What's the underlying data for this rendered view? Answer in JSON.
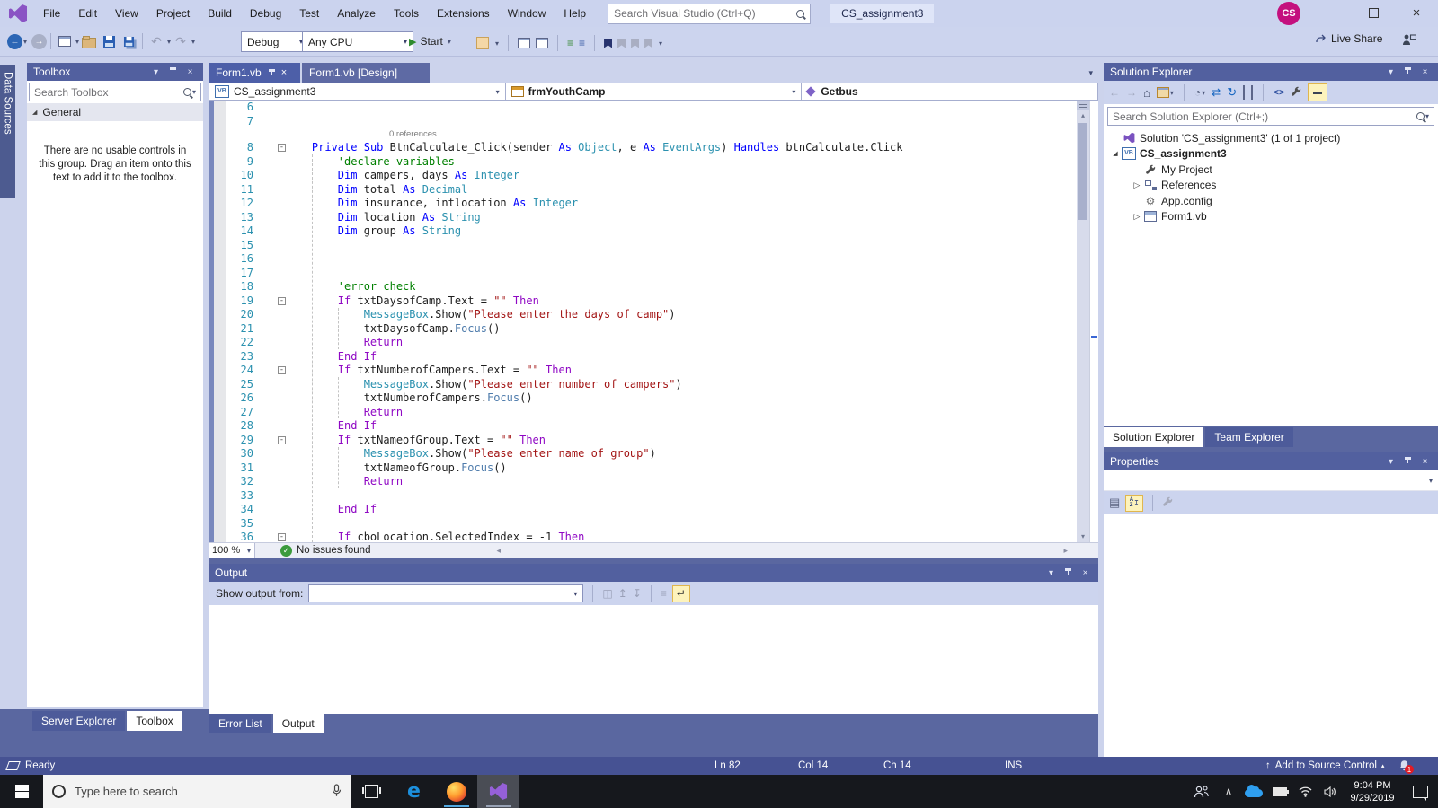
{
  "colors": {
    "accent_tab": "#4D5FA8",
    "dock_bg": "#5A67A0",
    "panel_header": "#52609F",
    "statusbar": "#465293",
    "taskbar": "#16181D",
    "avatar": "#C4107E",
    "start_green": "#2E8B2E",
    "badge_red": "#E11B24"
  },
  "icons": {
    "chevron_down": "▾",
    "chevron_up": "▴",
    "close": "×",
    "check": "✓",
    "play": "▶",
    "back": "←",
    "forward": "→",
    "undo": "↶",
    "redo": "↷",
    "refresh": "↻",
    "sync": "⇄",
    "home": "⌂",
    "collapsed": "▷",
    "expanded": "◢",
    "up_arrow": "↑",
    "left_small": "◂",
    "right_small": "▸",
    "clock": "◔",
    "code_tags": "<>",
    "wrap": "↵",
    "column_icon": "◫",
    "up_bar": "↥",
    "down_bar": "↧",
    "lines": "≡",
    "chevron_taskbar": "∧",
    "grid": "▤"
  },
  "titlebar": {
    "menu": [
      "File",
      "Edit",
      "View",
      "Project",
      "Build",
      "Debug",
      "Test",
      "Analyze",
      "Tools",
      "Extensions",
      "Window",
      "Help"
    ],
    "search_placeholder": "Search Visual Studio (Ctrl+Q)",
    "session_label": "CS_assignment3",
    "avatar_initials": "CS"
  },
  "toolbar": {
    "config": "Debug",
    "platform": "Any CPU",
    "start_label": "Start",
    "live_share_label": "Live Share"
  },
  "toolbox": {
    "title": "Toolbox",
    "search_placeholder": "Search Toolbox",
    "group_label": "General",
    "empty_message": "There are no usable controls in this group. Drag an item onto this text to add it to the toolbox.",
    "side_tab": "Data Sources",
    "bottom_tabs": [
      {
        "label": "Server Explorer",
        "active": false
      },
      {
        "label": "Toolbox",
        "active": true
      }
    ]
  },
  "editor": {
    "tabs": [
      {
        "label": "Form1.vb",
        "active": true
      },
      {
        "label": "Form1.vb [Design]",
        "active": false
      }
    ],
    "nav_project": "CS_assignment3",
    "nav_type": "frmYouthCamp",
    "nav_member": "Getbus",
    "zoom_level": "100 %",
    "health_status": "No issues found",
    "syntax": {
      "k": "#0000FF",
      "t": "#2B91AF",
      "c": "#008000",
      "s": "#A31515",
      "p": "#8F08C4",
      "d": "#1E1E1E",
      "m": "#4F7CAC"
    },
    "code_lines": [
      {
        "n": "6",
        "parts": []
      },
      {
        "n": "7",
        "parts": []
      },
      {
        "lens": "0 references"
      },
      {
        "n": "8",
        "fold": true,
        "parts": [
          [
            "d",
            "    "
          ],
          [
            "k",
            "Private"
          ],
          [
            "d",
            " "
          ],
          [
            "k",
            "Sub"
          ],
          [
            "d",
            " BtnCalculate_Click(sender "
          ],
          [
            "k",
            "As"
          ],
          [
            "d",
            " "
          ],
          [
            "t",
            "Object"
          ],
          [
            "d",
            ", e "
          ],
          [
            "k",
            "As"
          ],
          [
            "d",
            " "
          ],
          [
            "t",
            "EventArgs"
          ],
          [
            "d",
            ") "
          ],
          [
            "k",
            "Handles"
          ],
          [
            "d",
            " btnCalculate.Click"
          ]
        ]
      },
      {
        "n": "9",
        "parts": [
          [
            "c",
            "        'declare variables"
          ]
        ]
      },
      {
        "n": "10",
        "parts": [
          [
            "d",
            "        "
          ],
          [
            "k",
            "Dim"
          ],
          [
            "d",
            " campers, days "
          ],
          [
            "k",
            "As"
          ],
          [
            "d",
            " "
          ],
          [
            "t",
            "Integer"
          ]
        ]
      },
      {
        "n": "11",
        "parts": [
          [
            "d",
            "        "
          ],
          [
            "k",
            "Dim"
          ],
          [
            "d",
            " total "
          ],
          [
            "k",
            "As"
          ],
          [
            "d",
            " "
          ],
          [
            "t",
            "Decimal"
          ]
        ]
      },
      {
        "n": "12",
        "parts": [
          [
            "d",
            "        "
          ],
          [
            "k",
            "Dim"
          ],
          [
            "d",
            " insurance, intlocation "
          ],
          [
            "k",
            "As"
          ],
          [
            "d",
            " "
          ],
          [
            "t",
            "Integer"
          ]
        ]
      },
      {
        "n": "13",
        "parts": [
          [
            "d",
            "        "
          ],
          [
            "k",
            "Dim"
          ],
          [
            "d",
            " location "
          ],
          [
            "k",
            "As"
          ],
          [
            "d",
            " "
          ],
          [
            "t",
            "String"
          ]
        ]
      },
      {
        "n": "14",
        "parts": [
          [
            "d",
            "        "
          ],
          [
            "k",
            "Dim"
          ],
          [
            "d",
            " group "
          ],
          [
            "k",
            "As"
          ],
          [
            "d",
            " "
          ],
          [
            "t",
            "String"
          ]
        ]
      },
      {
        "n": "15",
        "parts": []
      },
      {
        "n": "16",
        "parts": []
      },
      {
        "n": "17",
        "parts": []
      },
      {
        "n": "18",
        "parts": [
          [
            "c",
            "        'error check"
          ]
        ]
      },
      {
        "n": "19",
        "fold": true,
        "parts": [
          [
            "d",
            "        "
          ],
          [
            "p",
            "If"
          ],
          [
            "d",
            " txtDaysofCamp.Text = "
          ],
          [
            "s",
            "\"\""
          ],
          [
            "d",
            " "
          ],
          [
            "p",
            "Then"
          ]
        ]
      },
      {
        "n": "20",
        "parts": [
          [
            "d",
            "            "
          ],
          [
            "t",
            "MessageBox"
          ],
          [
            "d",
            ".Show("
          ],
          [
            "s",
            "\"Please enter the days of camp\""
          ],
          [
            "d",
            ")"
          ]
        ]
      },
      {
        "n": "21",
        "parts": [
          [
            "d",
            "            txtDaysofCamp."
          ],
          [
            "m",
            "Focus"
          ],
          [
            "d",
            "()"
          ]
        ]
      },
      {
        "n": "22",
        "parts": [
          [
            "d",
            "            "
          ],
          [
            "p",
            "Return"
          ]
        ]
      },
      {
        "n": "23",
        "parts": [
          [
            "d",
            "        "
          ],
          [
            "p",
            "End If"
          ]
        ]
      },
      {
        "n": "24",
        "fold": true,
        "parts": [
          [
            "d",
            "        "
          ],
          [
            "p",
            "If"
          ],
          [
            "d",
            " txtNumberofCampers.Text = "
          ],
          [
            "s",
            "\"\""
          ],
          [
            "d",
            " "
          ],
          [
            "p",
            "Then"
          ]
        ]
      },
      {
        "n": "25",
        "parts": [
          [
            "d",
            "            "
          ],
          [
            "t",
            "MessageBox"
          ],
          [
            "d",
            ".Show("
          ],
          [
            "s",
            "\"Please enter number of campers\""
          ],
          [
            "d",
            ")"
          ]
        ]
      },
      {
        "n": "26",
        "parts": [
          [
            "d",
            "            txtNumberofCampers."
          ],
          [
            "m",
            "Focus"
          ],
          [
            "d",
            "()"
          ]
        ]
      },
      {
        "n": "27",
        "parts": [
          [
            "d",
            "            "
          ],
          [
            "p",
            "Return"
          ]
        ]
      },
      {
        "n": "28",
        "parts": [
          [
            "d",
            "        "
          ],
          [
            "p",
            "End If"
          ]
        ]
      },
      {
        "n": "29",
        "fold": true,
        "parts": [
          [
            "d",
            "        "
          ],
          [
            "p",
            "If"
          ],
          [
            "d",
            " txtNameofGroup.Text = "
          ],
          [
            "s",
            "\"\""
          ],
          [
            "d",
            " "
          ],
          [
            "p",
            "Then"
          ]
        ]
      },
      {
        "n": "30",
        "parts": [
          [
            "d",
            "            "
          ],
          [
            "t",
            "MessageBox"
          ],
          [
            "d",
            ".Show("
          ],
          [
            "s",
            "\"Please enter name of group\""
          ],
          [
            "d",
            ")"
          ]
        ]
      },
      {
        "n": "31",
        "parts": [
          [
            "d",
            "            txtNameofGroup."
          ],
          [
            "m",
            "Focus"
          ],
          [
            "d",
            "()"
          ]
        ]
      },
      {
        "n": "32",
        "parts": [
          [
            "d",
            "            "
          ],
          [
            "p",
            "Return"
          ]
        ]
      },
      {
        "n": "33",
        "parts": []
      },
      {
        "n": "34",
        "parts": [
          [
            "d",
            "        "
          ],
          [
            "p",
            "End If"
          ]
        ]
      },
      {
        "n": "35",
        "parts": []
      },
      {
        "n": "36",
        "fold": true,
        "parts": [
          [
            "d",
            "        "
          ],
          [
            "p",
            "If"
          ],
          [
            "d",
            " cboLocation.SelectedIndex = -1 "
          ],
          [
            "p",
            "Then"
          ]
        ]
      }
    ]
  },
  "output": {
    "title": "Output",
    "show_output_from_label": "Show output from:",
    "bottom_tabs": [
      {
        "label": "Error List",
        "active": false
      },
      {
        "label": "Output",
        "active": true
      }
    ]
  },
  "solution_explorer": {
    "title": "Solution Explorer",
    "search_placeholder": "Search Solution Explorer (Ctrl+;)",
    "tree": [
      {
        "arrow": "",
        "icon": "solution",
        "label": "Solution 'CS_assignment3' (1 of 1 project)",
        "bold": false,
        "indent": 0
      },
      {
        "arrow": "expanded",
        "icon": "vb",
        "label": "CS_assignment3",
        "bold": true,
        "indent": 0
      },
      {
        "arrow": "",
        "icon": "wrench",
        "label": "My Project",
        "bold": false,
        "indent": 1
      },
      {
        "arrow": "collapsed",
        "icon": "refs",
        "label": "References",
        "bold": false,
        "indent": 1
      },
      {
        "arrow": "",
        "icon": "config",
        "label": "App.config",
        "bold": false,
        "indent": 1
      },
      {
        "arrow": "collapsed",
        "icon": "form",
        "label": "Form1.vb",
        "bold": false,
        "indent": 1
      }
    ],
    "bottom_tabs": [
      {
        "label": "Solution Explorer",
        "active": true
      },
      {
        "label": "Team Explorer",
        "active": false
      }
    ]
  },
  "properties": {
    "title": "Properties"
  },
  "statusbar": {
    "ready": "Ready",
    "line": "Ln 82",
    "column": "Col 14",
    "character": "Ch 14",
    "mode": "INS",
    "source_control": "Add to Source Control",
    "notifications_badge": "1"
  },
  "taskbar": {
    "search_placeholder": "Type here to search",
    "time": "9:04 PM",
    "date": "9/29/2019"
  }
}
